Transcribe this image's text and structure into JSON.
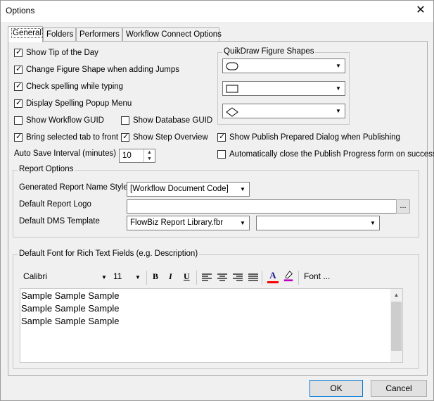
{
  "window": {
    "title": "Options",
    "close_glyph": "✕"
  },
  "tabs": [
    {
      "label": "General"
    },
    {
      "label": "Folders"
    },
    {
      "label": "Performers"
    },
    {
      "label": "Workflow Connect Options"
    }
  ],
  "general": {
    "checkboxes": {
      "show_tip": {
        "label": "Show Tip of the Day",
        "checked": true
      },
      "change_shape": {
        "label": "Change Figure Shape when adding Jumps",
        "checked": true
      },
      "check_spelling": {
        "label": "Check spelling while typing",
        "checked": true
      },
      "display_spelling_popup": {
        "label": "Display Spelling Popup Menu",
        "checked": true
      },
      "show_workflow_guid": {
        "label": "Show Workflow GUID",
        "checked": false
      },
      "show_database_guid": {
        "label": "Show Database GUID",
        "checked": false
      },
      "bring_selected_tab": {
        "label": "Bring selected tab to front",
        "checked": true
      },
      "show_step_overview": {
        "label": "Show Step Overview",
        "checked": true
      },
      "show_publish_prepared": {
        "label": "Show Publish Prepared Dialog when Publishing",
        "checked": true
      },
      "auto_close_publish": {
        "label": "Automatically close the Publish Progress form on success",
        "checked": false
      }
    },
    "auto_save": {
      "label": "Auto Save Interval (minutes)",
      "value": "10"
    },
    "quikdraw": {
      "title": "QuikDraw Figure Shapes",
      "shapes": [
        "rounded-oval-shape",
        "rectangle-shape",
        "diamond-shape"
      ]
    },
    "report_options": {
      "title": "Report Options",
      "name_style_label": "Generated Report Name Style",
      "name_style_value": "[Workflow Document Code]",
      "logo_label": "Default Report Logo",
      "logo_value": "",
      "browse_label": "...",
      "dms_label": "Default DMS Template",
      "dms_value": "FlowBiz Report Library.fbr",
      "dms_second_value": ""
    },
    "font_section": {
      "title": "Default Font for Rich Text Fields (e.g. Description)",
      "font_name": "Calibri",
      "font_size": "11",
      "bold": "B",
      "italic": "I",
      "underline": "U",
      "font_button": "Font ...",
      "font_color_glyph": "A",
      "sample_lines": [
        "Sample Sample Sample",
        "Sample Sample Sample",
        "Sample Sample Sample"
      ],
      "font_color": "#ff0000",
      "highlight_color": "#c000c0"
    }
  },
  "buttons": {
    "ok": "OK",
    "cancel": "Cancel"
  },
  "colors": {
    "accent": "#0078d7"
  }
}
